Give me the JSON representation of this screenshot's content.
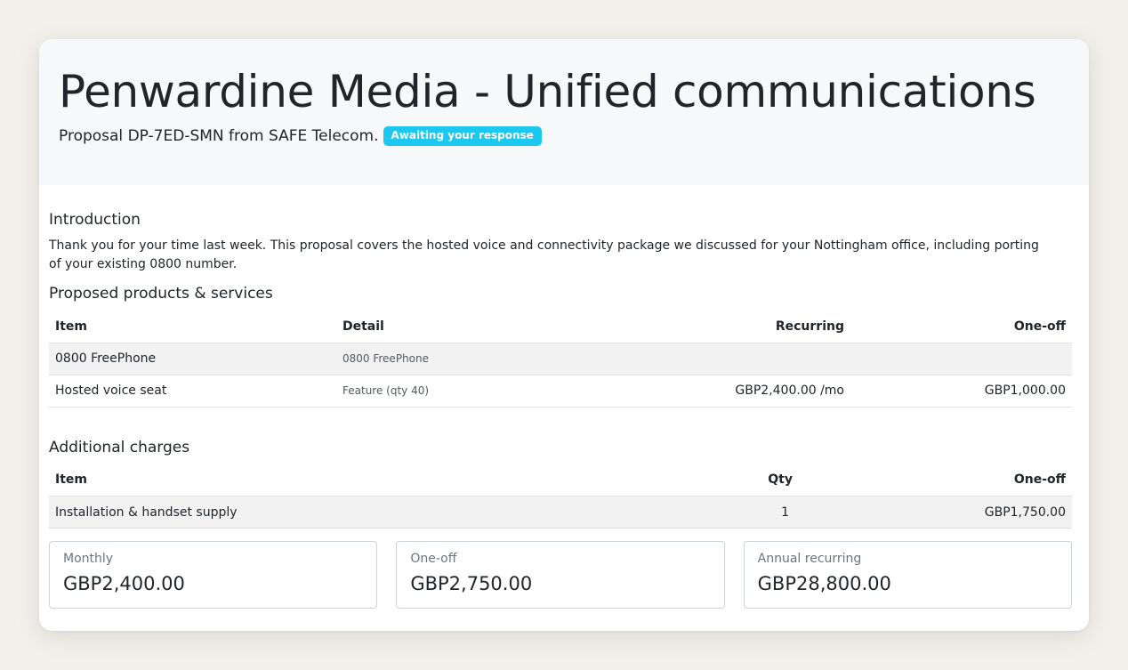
{
  "proposal": {
    "title": "Penwardine Media - Unified communications",
    "subtitle": "Proposal DP-7ED-SMN from SAFE Telecom.",
    "status_badge": "Awaiting your response"
  },
  "introduction": {
    "heading": "Introduction",
    "body": "Thank you for your time last week. This proposal covers the hosted voice and connectivity package we discussed for your Nottingham office, including porting of your existing 0800 number."
  },
  "products": {
    "heading": "Proposed products & services",
    "columns": [
      "Item",
      "Detail",
      "Recurring",
      "One-off"
    ],
    "rows": [
      {
        "item": "0800 FreePhone",
        "detail": "0800 FreePhone",
        "recurring": "",
        "oneoff": ""
      },
      {
        "item": "Hosted voice seat",
        "detail": "Feature (qty 40)",
        "recurring": "GBP2,400.00 /mo",
        "oneoff": "GBP1,000.00"
      }
    ]
  },
  "charges": {
    "heading": "Additional charges",
    "columns": [
      "Item",
      "Qty",
      "One-off"
    ],
    "rows": [
      {
        "item": "Installation & handset supply",
        "qty": "1",
        "oneoff": "GBP1,750.00"
      }
    ]
  },
  "totals": [
    {
      "label": "Monthly",
      "value": "GBP2,400.00"
    },
    {
      "label": "One-off",
      "value": "GBP2,750.00"
    },
    {
      "label": "Annual recurring",
      "value": "GBP28,800.00"
    }
  ],
  "colors": {
    "badge": "#1cc8ef",
    "hero_background": "#f6f8fa",
    "page_background": "#f2f0eb"
  }
}
